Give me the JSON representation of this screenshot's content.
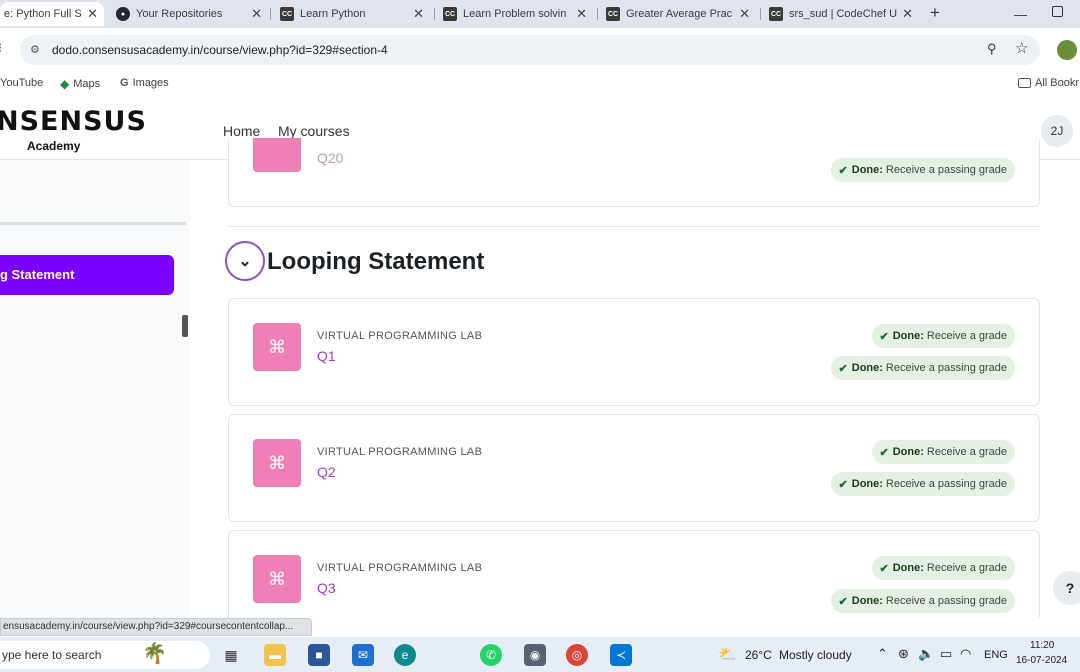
{
  "browser": {
    "tabs": [
      {
        "title": "e: Python Full S",
        "active": true,
        "icon": "site-favicon"
      },
      {
        "title": "Your Repositories",
        "active": false,
        "icon": "github-icon"
      },
      {
        "title": "Learn Python",
        "active": false,
        "icon": "codechef-icon"
      },
      {
        "title": "Learn Problem solvin",
        "active": false,
        "icon": "codechef-icon"
      },
      {
        "title": "Greater Average Prac",
        "active": false,
        "icon": "codechef-icon"
      },
      {
        "title": "srs_sud | CodeChef U",
        "active": false,
        "icon": "codechef-icon"
      }
    ],
    "tab_close_glyph": "✕",
    "new_tab_glyph": "+",
    "url": "dodo.consensusacademy.in/course/view.php?id=329#section-4",
    "bookmarks": [
      "YouTube",
      "Maps",
      "Images"
    ],
    "all_bookmarks": "All Bookr"
  },
  "site": {
    "logo_main": "NSENSUS",
    "logo_sub": "Academy",
    "nav": [
      "Home",
      "My courses"
    ],
    "avatar_initials": "2J"
  },
  "drawer": {
    "active_item": "g Statement"
  },
  "course": {
    "previous_item_partial": "Q20",
    "previous_badge": {
      "done": "Done:",
      "text": "Receive a passing grade"
    },
    "section_title": "Looping Statement",
    "activities": [
      {
        "type": "VIRTUAL PROGRAMMING LAB",
        "name": "Q1",
        "badges": [
          {
            "done": "Done:",
            "text": "Receive a grade"
          },
          {
            "done": "Done:",
            "text": "Receive a passing grade"
          }
        ]
      },
      {
        "type": "VIRTUAL PROGRAMMING LAB",
        "name": "Q2",
        "badges": [
          {
            "done": "Done:",
            "text": "Receive a grade"
          },
          {
            "done": "Done:",
            "text": "Receive a passing grade"
          }
        ]
      },
      {
        "type": "VIRTUAL PROGRAMMING LAB",
        "name": "Q3",
        "badges": [
          {
            "done": "Done:",
            "text": "Receive a grade"
          },
          {
            "done": "Done:",
            "text": "Receive a passing grade"
          }
        ]
      }
    ],
    "help_label": "?"
  },
  "status_link": "ensusacademy.in/course/view.php?id=329#coursecontentcollap...",
  "taskbar": {
    "search_placeholder": "ype here to search",
    "weather_temp": "26°C",
    "weather_desc": "Mostly cloudy",
    "language": "ENG",
    "time": "11:20",
    "date": "16-07-2024"
  },
  "colors": {
    "accent": "#7b00ff",
    "activity_icon": "#f07fb6",
    "activity_link": "#9b3fd4",
    "badge_bg": "#e3f0e3"
  }
}
